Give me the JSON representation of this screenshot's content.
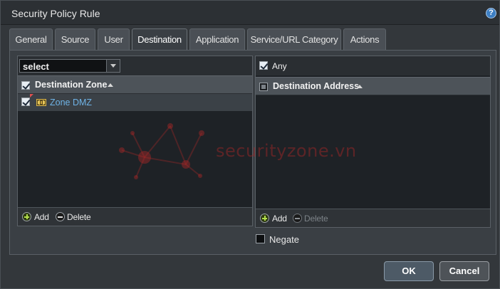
{
  "dialog": {
    "title": "Security Policy Rule",
    "help_icon": "?"
  },
  "tabs": [
    {
      "label": "General",
      "active": false
    },
    {
      "label": "Source",
      "active": false
    },
    {
      "label": "User",
      "active": false
    },
    {
      "label": "Destination",
      "active": true
    },
    {
      "label": "Application",
      "active": false
    },
    {
      "label": "Service/URL Category",
      "active": false
    },
    {
      "label": "Actions",
      "active": false
    }
  ],
  "destination_zone": {
    "select_value": "select",
    "header": "Destination Zone",
    "header_checked": true,
    "items": [
      {
        "label": "Zone DMZ",
        "checked": true,
        "icon": "zone-icon"
      }
    ],
    "add_label": "Add",
    "delete_label": "Delete"
  },
  "destination_address": {
    "any_label": "Any",
    "any_checked": true,
    "header": "Destination Address",
    "items": [],
    "add_label": "Add",
    "delete_label": "Delete",
    "delete_disabled": true
  },
  "negate": {
    "label": "Negate",
    "checked": false
  },
  "watermark": {
    "text": "securityzone.vn"
  },
  "buttons": {
    "ok_label": "OK",
    "cancel_label": "Cancel"
  },
  "colors": {
    "accent_link": "#6fb3e6",
    "add_green": "#b4e04b",
    "watermark_red": "#aa2828"
  }
}
